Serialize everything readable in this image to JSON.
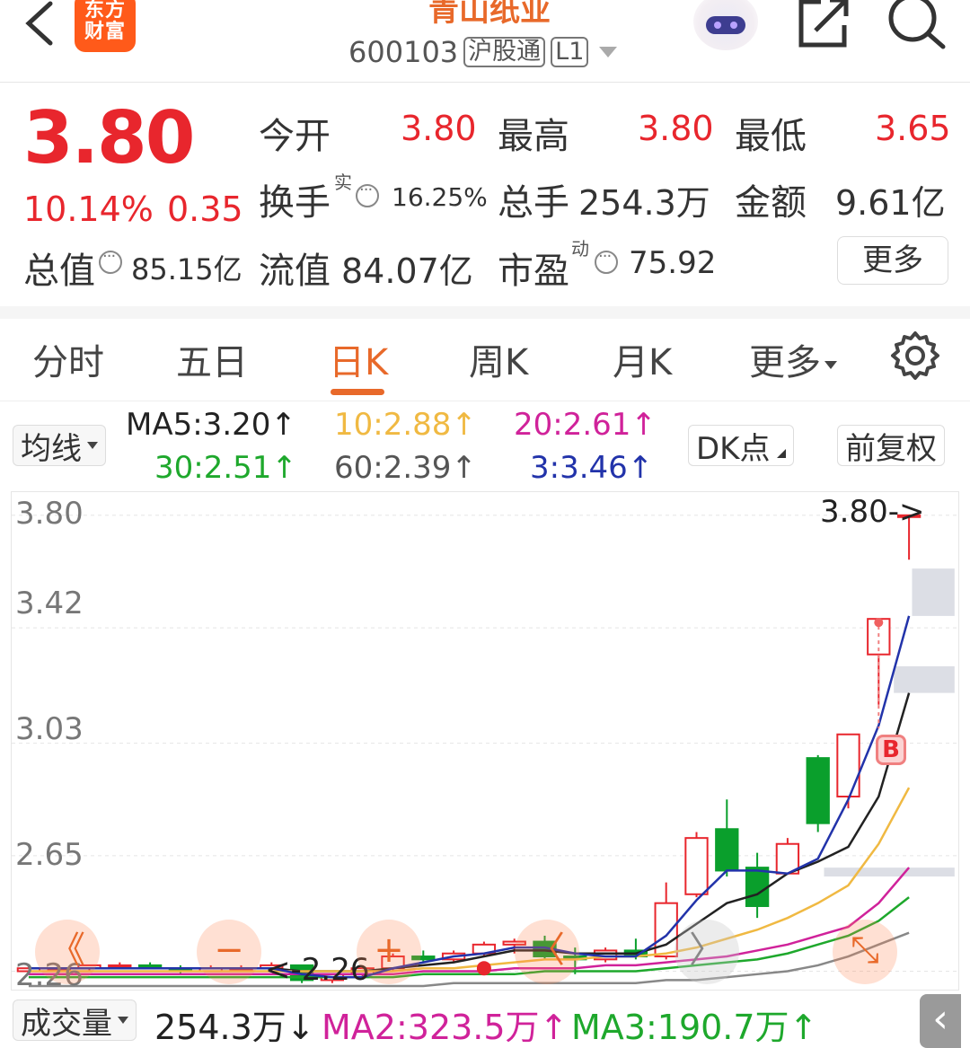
{
  "header": {
    "logo_text": "东方财富",
    "title": "青山纸业",
    "code": "600103",
    "tags": [
      "沪股通",
      "L1"
    ]
  },
  "quote": {
    "price": "3.80",
    "change_pct": "10.14%",
    "change_amt": "0.35",
    "open_label": "今开",
    "open": "3.80",
    "high_label": "最高",
    "high": "3.80",
    "low_label": "最低",
    "low": "3.65",
    "turnover_label": "换手",
    "turnover_sup": "实",
    "turnover": "16.25%",
    "volume_label": "总手",
    "volume": "254.3万",
    "amount_label": "金额",
    "amount": "9.61亿",
    "mktcap_label": "总值",
    "mktcap": "85.15亿",
    "float_label": "流值",
    "float_cap": "84.07亿",
    "pe_label": "市盈",
    "pe_sup": "动",
    "pe": "75.92",
    "more_label": "更多"
  },
  "tabs": [
    {
      "label": "分时"
    },
    {
      "label": "五日"
    },
    {
      "label": "日K"
    },
    {
      "label": "周K"
    },
    {
      "label": "月K"
    },
    {
      "label": "更多"
    }
  ],
  "ma_row": {
    "selector": "均线",
    "ma5": "MA5:3.20↑",
    "ma10": "10:2.88↑",
    "ma20": "20:2.61↑",
    "ma30": "30:2.51↑",
    "ma60": "60:2.39↑",
    "ma3": "3:3.46↑",
    "dk_label": "DK点",
    "adjust_label": "前复权"
  },
  "colors": {
    "up": "#e8262d",
    "down": "#0a9f2c",
    "accent": "#e8692a",
    "ma5": "#222222",
    "ma10": "#f0b942",
    "ma20": "#d0229a",
    "ma30": "#1ea82c",
    "ma60": "#888888",
    "ma3": "#2233aa"
  },
  "icons": [
    "back-icon",
    "share-icon",
    "search-icon",
    "gear-icon",
    "robot-icon"
  ],
  "chart_data": {
    "type": "candlestick",
    "y_ticks": [
      "3.80",
      "3.42",
      "3.03",
      "2.65",
      "2.26"
    ],
    "ylim": [
      2.21,
      3.86
    ],
    "last_price_label": "3.80->",
    "low_label": "<-2.26",
    "buy_marker": "B",
    "float_buttons": [
      "《",
      "−",
      "+",
      "〈",
      "〉",
      "⤡"
    ],
    "candles": [
      {
        "o": 2.26,
        "h": 2.28,
        "l": 2.25,
        "c": 2.27
      },
      {
        "o": 2.27,
        "h": 2.28,
        "l": 2.26,
        "c": 2.27
      },
      {
        "o": 2.27,
        "h": 2.28,
        "l": 2.26,
        "c": 2.28
      },
      {
        "o": 2.28,
        "h": 2.29,
        "l": 2.27,
        "c": 2.28
      },
      {
        "o": 2.28,
        "h": 2.29,
        "l": 2.27,
        "c": 2.27
      },
      {
        "o": 2.27,
        "h": 2.28,
        "l": 2.25,
        "c": 2.26
      },
      {
        "o": 2.26,
        "h": 2.28,
        "l": 2.26,
        "c": 2.27
      },
      {
        "o": 2.27,
        "h": 2.28,
        "l": 2.26,
        "c": 2.27
      },
      {
        "o": 2.27,
        "h": 2.29,
        "l": 2.26,
        "c": 2.28
      },
      {
        "o": 2.28,
        "h": 2.28,
        "l": 2.22,
        "c": 2.23
      },
      {
        "o": 2.23,
        "h": 2.25,
        "l": 2.22,
        "c": 2.25
      },
      {
        "o": 2.25,
        "h": 2.28,
        "l": 2.24,
        "c": 2.27
      },
      {
        "o": 2.27,
        "h": 2.32,
        "l": 2.26,
        "c": 2.31
      },
      {
        "o": 2.31,
        "h": 2.33,
        "l": 2.29,
        "c": 2.3
      },
      {
        "o": 2.3,
        "h": 2.33,
        "l": 2.29,
        "c": 2.32
      },
      {
        "o": 2.32,
        "h": 2.36,
        "l": 2.31,
        "c": 2.35
      },
      {
        "o": 2.35,
        "h": 2.37,
        "l": 2.32,
        "c": 2.36
      },
      {
        "o": 2.36,
        "h": 2.38,
        "l": 2.3,
        "c": 2.31
      },
      {
        "o": 2.31,
        "h": 2.34,
        "l": 2.25,
        "c": 2.3
      },
      {
        "o": 2.3,
        "h": 2.34,
        "l": 2.29,
        "c": 2.33
      },
      {
        "o": 2.33,
        "h": 2.37,
        "l": 2.3,
        "c": 2.31
      },
      {
        "o": 2.31,
        "h": 2.56,
        "l": 2.3,
        "c": 2.49
      },
      {
        "o": 2.52,
        "h": 2.73,
        "l": 2.51,
        "c": 2.71
      },
      {
        "o": 2.74,
        "h": 2.84,
        "l": 2.58,
        "c": 2.6
      },
      {
        "o": 2.61,
        "h": 2.66,
        "l": 2.44,
        "c": 2.48
      },
      {
        "o": 2.59,
        "h": 2.71,
        "l": 2.59,
        "c": 2.69
      },
      {
        "o": 2.98,
        "h": 2.99,
        "l": 2.73,
        "c": 2.76
      },
      {
        "o": 2.85,
        "h": 3.06,
        "l": 2.81,
        "c": 3.06
      },
      {
        "o": 3.33,
        "h": 3.45,
        "l": 3.16,
        "c": 3.45
      },
      {
        "o": 3.8,
        "h": 3.8,
        "l": 3.65,
        "c": 3.8
      }
    ],
    "ma_lines": [
      {
        "name": "MA5",
        "values": [
          2.27,
          2.27,
          2.27,
          2.27,
          2.27,
          2.27,
          2.27,
          2.27,
          2.27,
          2.26,
          2.26,
          2.26,
          2.27,
          2.28,
          2.29,
          2.31,
          2.33,
          2.33,
          2.32,
          2.32,
          2.32,
          2.35,
          2.42,
          2.49,
          2.52,
          2.59,
          2.63,
          2.68,
          2.85,
          3.2
        ]
      },
      {
        "name": "MA10",
        "values": [
          2.26,
          2.26,
          2.26,
          2.26,
          2.26,
          2.26,
          2.26,
          2.26,
          2.26,
          2.26,
          2.26,
          2.26,
          2.26,
          2.27,
          2.27,
          2.28,
          2.29,
          2.3,
          2.3,
          2.31,
          2.31,
          2.32,
          2.34,
          2.37,
          2.4,
          2.44,
          2.49,
          2.55,
          2.69,
          2.88
        ]
      },
      {
        "name": "MA20",
        "values": [
          2.25,
          2.25,
          2.25,
          2.25,
          2.25,
          2.25,
          2.25,
          2.25,
          2.25,
          2.25,
          2.25,
          2.25,
          2.25,
          2.26,
          2.26,
          2.26,
          2.27,
          2.27,
          2.27,
          2.28,
          2.28,
          2.29,
          2.3,
          2.31,
          2.33,
          2.35,
          2.38,
          2.41,
          2.49,
          2.61
        ]
      },
      {
        "name": "MA30",
        "values": [
          2.24,
          2.24,
          2.24,
          2.24,
          2.24,
          2.24,
          2.24,
          2.24,
          2.24,
          2.24,
          2.24,
          2.24,
          2.24,
          2.25,
          2.25,
          2.25,
          2.25,
          2.26,
          2.26,
          2.26,
          2.26,
          2.27,
          2.28,
          2.29,
          2.3,
          2.32,
          2.35,
          2.38,
          2.43,
          2.51
        ]
      },
      {
        "name": "MA60",
        "values": [
          2.21,
          2.21,
          2.21,
          2.21,
          2.21,
          2.21,
          2.21,
          2.21,
          2.21,
          2.21,
          2.21,
          2.21,
          2.21,
          2.21,
          2.22,
          2.22,
          2.22,
          2.22,
          2.22,
          2.22,
          2.22,
          2.23,
          2.23,
          2.24,
          2.25,
          2.26,
          2.28,
          2.31,
          2.35,
          2.39
        ]
      },
      {
        "name": "MA3",
        "values": [
          2.27,
          2.27,
          2.27,
          2.27,
          2.27,
          2.27,
          2.27,
          2.27,
          2.27,
          2.25,
          2.24,
          2.24,
          2.27,
          2.29,
          2.31,
          2.32,
          2.34,
          2.34,
          2.32,
          2.31,
          2.31,
          2.38,
          2.5,
          2.6,
          2.6,
          2.59,
          2.64,
          2.84,
          3.09,
          3.46
        ]
      }
    ],
    "zones": [
      {
        "x_from": 26.7,
        "x_to": 31,
        "y_from": 2.58,
        "y_to": 2.61
      },
      {
        "x_from": 29.0,
        "x_to": 31,
        "y_from": 3.2,
        "y_to": 3.29
      },
      {
        "x_from": 29.6,
        "x_to": 31,
        "y_from": 3.46,
        "y_to": 3.62
      }
    ]
  },
  "volume_row": {
    "selector": "成交量",
    "volume": "254.3万↓",
    "ma2": "MA2:323.5万↑",
    "ma3": "MA3:190.7万↑"
  }
}
